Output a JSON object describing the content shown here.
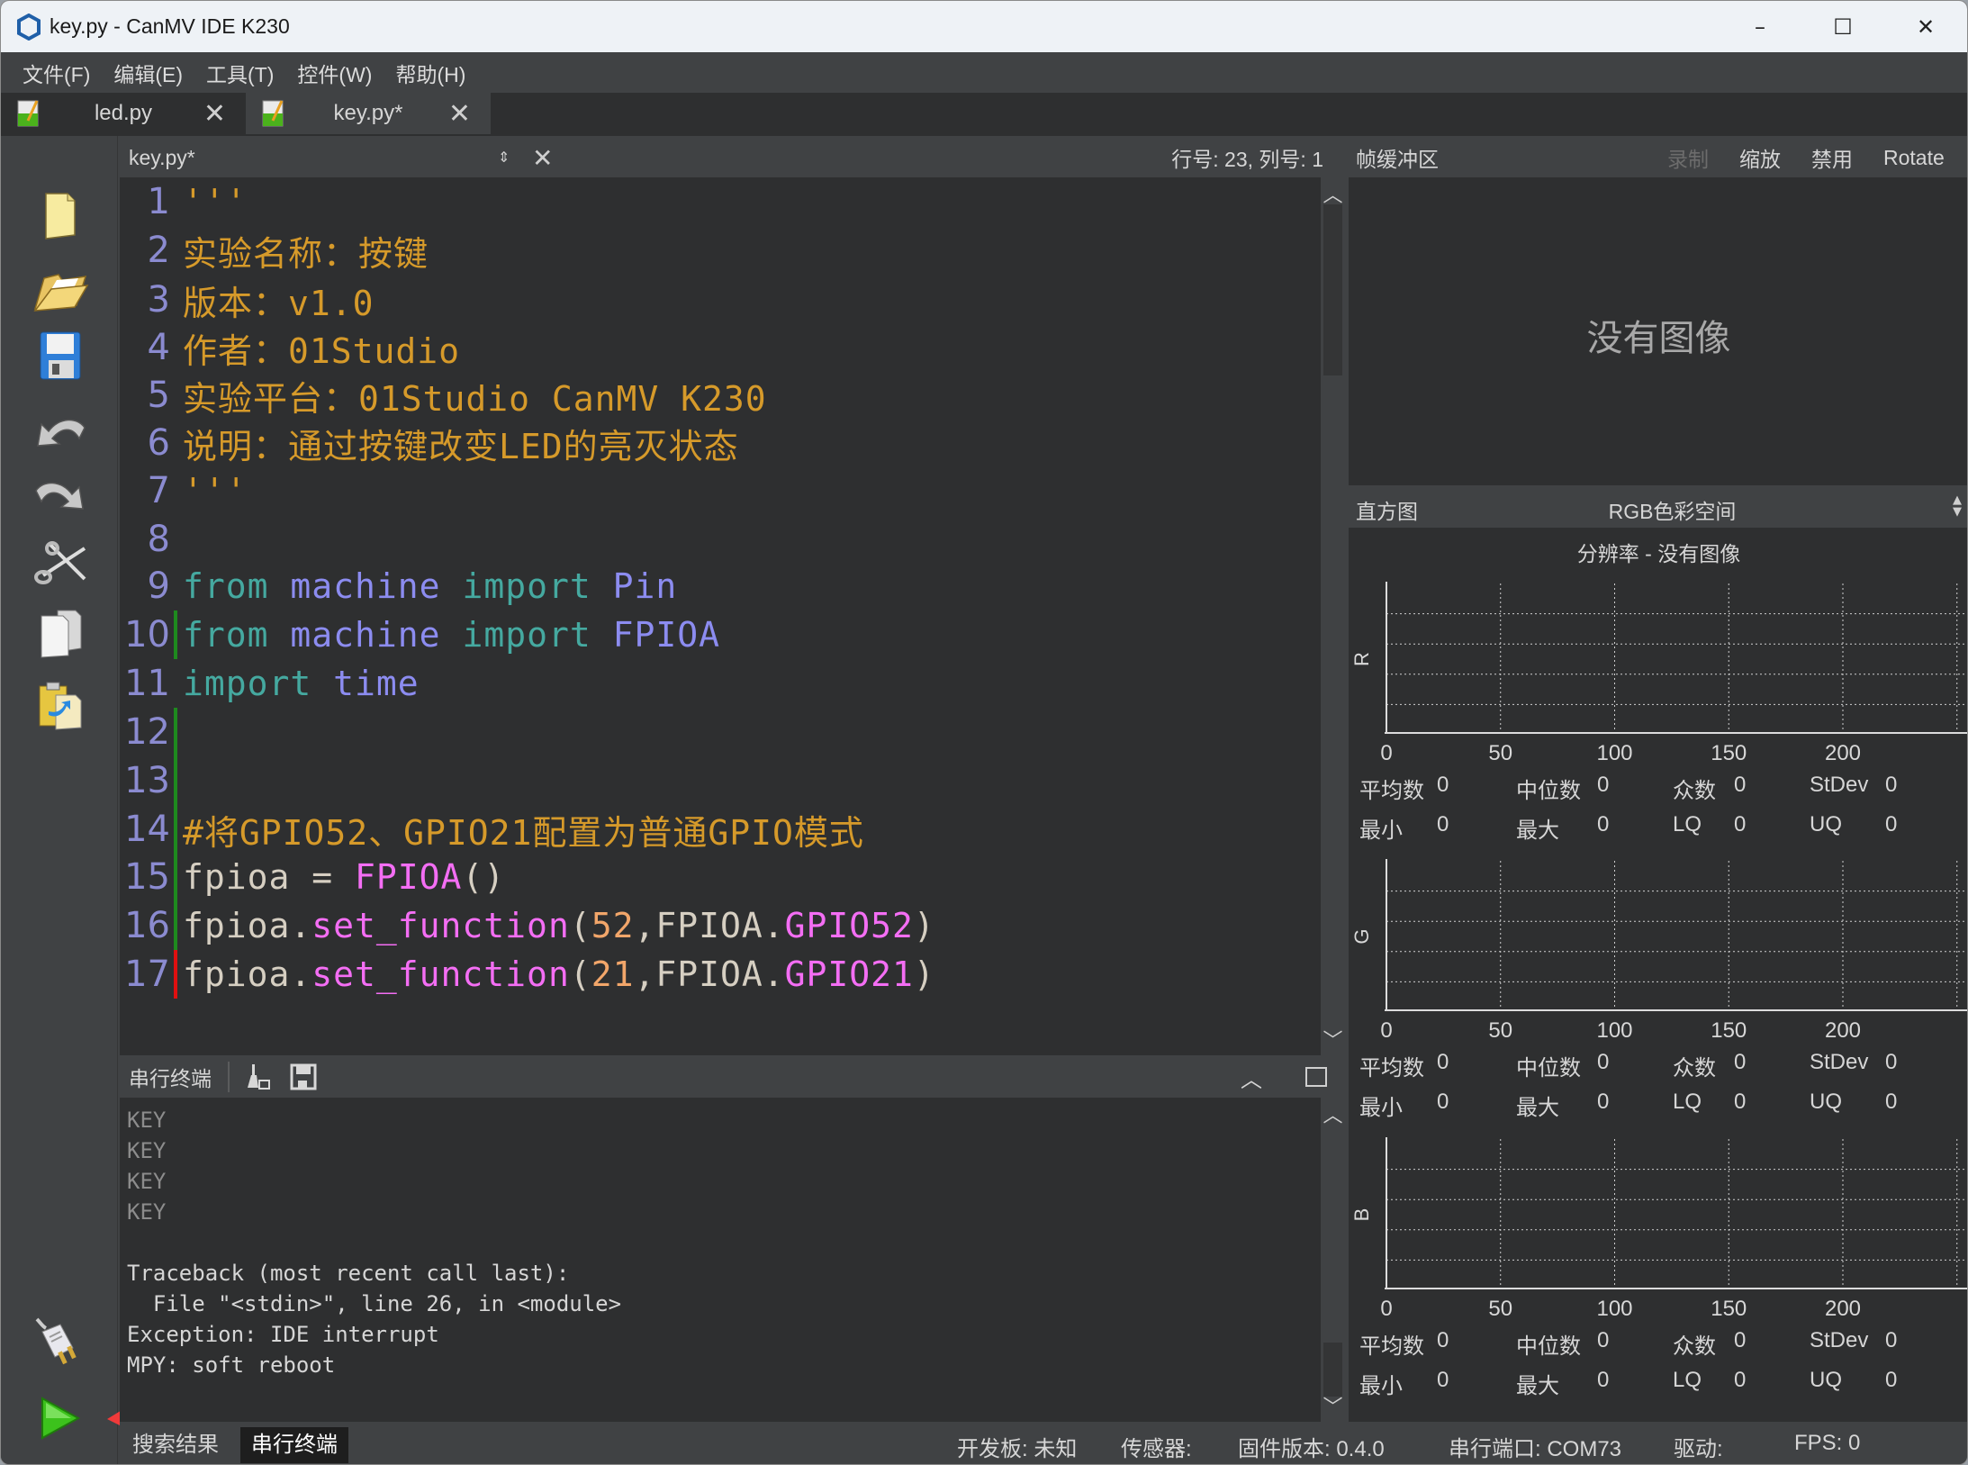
{
  "window": {
    "title": "key.py - CanMV IDE K230",
    "controls": {
      "minimize": "–",
      "maximize": "☐",
      "close": "✕"
    }
  },
  "menu": [
    "文件(F)",
    "编辑(E)",
    "工具(T)",
    "控件(W)",
    "帮助(H)"
  ],
  "tabs": [
    {
      "label": "led.py",
      "active": false,
      "close": "✕"
    },
    {
      "label": "key.py*",
      "active": true,
      "close": "✕"
    }
  ],
  "toolbar": {
    "icons": [
      "new-file-icon",
      "open-folder-icon",
      "save-icon",
      "undo-icon",
      "redo-icon",
      "cut-icon",
      "copy-icon",
      "paste-icon"
    ],
    "connect_icon": "connect-plug-icon",
    "run_icon": "run-icon"
  },
  "editor": {
    "document": "key.py*",
    "switch_glyph": "⇕",
    "close_glyph": "✕",
    "cursor_position": "行号: 23, 列号: 1",
    "lines": [
      {
        "n": "1",
        "mark": "",
        "tokens": [
          {
            "c": "str",
            "t": "'''"
          }
        ]
      },
      {
        "n": "2",
        "mark": "",
        "tokens": [
          {
            "c": "str",
            "t": "实验名称：按键"
          }
        ]
      },
      {
        "n": "3",
        "mark": "",
        "tokens": [
          {
            "c": "str",
            "t": "版本：v1.0"
          }
        ]
      },
      {
        "n": "4",
        "mark": "",
        "tokens": [
          {
            "c": "str",
            "t": "作者：01Studio"
          }
        ]
      },
      {
        "n": "5",
        "mark": "",
        "tokens": [
          {
            "c": "str",
            "t": "实验平台：01Studio CanMV K230"
          }
        ]
      },
      {
        "n": "6",
        "mark": "",
        "tokens": [
          {
            "c": "str",
            "t": "说明：通过按键改变LED的亮灭状态"
          }
        ]
      },
      {
        "n": "7",
        "mark": "",
        "tokens": [
          {
            "c": "str",
            "t": "'''"
          }
        ]
      },
      {
        "n": "8",
        "mark": "",
        "tokens": []
      },
      {
        "n": "9",
        "mark": "",
        "tokens": [
          {
            "c": "kw",
            "t": "from"
          },
          {
            "c": "plain",
            "t": " "
          },
          {
            "c": "mod",
            "t": "machine"
          },
          {
            "c": "plain",
            "t": " "
          },
          {
            "c": "kw",
            "t": "import"
          },
          {
            "c": "plain",
            "t": " "
          },
          {
            "c": "mod",
            "t": "Pin"
          }
        ]
      },
      {
        "n": "10",
        "mark": "green",
        "tokens": [
          {
            "c": "kw",
            "t": "from"
          },
          {
            "c": "plain",
            "t": " "
          },
          {
            "c": "mod",
            "t": "machine"
          },
          {
            "c": "plain",
            "t": " "
          },
          {
            "c": "kw",
            "t": "import"
          },
          {
            "c": "plain",
            "t": " "
          },
          {
            "c": "mod",
            "t": "FPIOA"
          }
        ]
      },
      {
        "n": "11",
        "mark": "",
        "tokens": [
          {
            "c": "kw",
            "t": "import"
          },
          {
            "c": "plain",
            "t": " "
          },
          {
            "c": "mod",
            "t": "time"
          }
        ]
      },
      {
        "n": "12",
        "mark": "green",
        "tokens": []
      },
      {
        "n": "13",
        "mark": "green",
        "tokens": []
      },
      {
        "n": "14",
        "mark": "green",
        "tokens": [
          {
            "c": "str",
            "t": "#将GPIO52、GPIO21配置为普通GPIO模式"
          }
        ]
      },
      {
        "n": "15",
        "mark": "green",
        "tokens": [
          {
            "c": "plain",
            "t": "fpioa = "
          },
          {
            "c": "pink",
            "t": "FPIOA"
          },
          {
            "c": "plain",
            "t": "()"
          }
        ]
      },
      {
        "n": "16",
        "mark": "green",
        "tokens": [
          {
            "c": "plain",
            "t": "fpioa."
          },
          {
            "c": "pink",
            "t": "set_function"
          },
          {
            "c": "plain",
            "t": "("
          },
          {
            "c": "num",
            "t": "52"
          },
          {
            "c": "plain",
            "t": ",FPIOA."
          },
          {
            "c": "pink",
            "t": "GPIO52"
          },
          {
            "c": "plain",
            "t": ")"
          }
        ]
      },
      {
        "n": "17",
        "mark": "red",
        "tokens": [
          {
            "c": "plain",
            "t": "fpioa."
          },
          {
            "c": "pink",
            "t": "set_function"
          },
          {
            "c": "plain",
            "t": "("
          },
          {
            "c": "num",
            "t": "21"
          },
          {
            "c": "plain",
            "t": ",FPIOA."
          },
          {
            "c": "pink",
            "t": "GPIO21"
          },
          {
            "c": "plain",
            "t": ")"
          }
        ]
      }
    ]
  },
  "terminal": {
    "title": "串行终端",
    "clear_icon": "clear-broom-icon",
    "save_icon": "save-log-icon",
    "lines": [
      {
        "t": "KEY",
        "dim": true
      },
      {
        "t": "KEY",
        "dim": true
      },
      {
        "t": "KEY",
        "dim": true
      },
      {
        "t": "KEY",
        "dim": true
      },
      {
        "t": "",
        "dim": false
      },
      {
        "t": "Traceback (most recent call last):",
        "dim": false
      },
      {
        "t": "  File \"<stdin>\", line 26, in <module>",
        "dim": false
      },
      {
        "t": "Exception: IDE interrupt",
        "dim": false
      },
      {
        "t": "MPY: soft reboot",
        "dim": false
      }
    ]
  },
  "bottom_tabs": [
    {
      "label": "搜索结果",
      "active": false
    },
    {
      "label": "串行终端",
      "active": true
    }
  ],
  "status": {
    "board": "开发板: 未知",
    "sensor": "传感器:",
    "firmware": "固件版本: 0.4.0",
    "port": "串行端口: COM73",
    "driver": "驱动:",
    "fps": "FPS: 0"
  },
  "framebuffer": {
    "title": "帧缓冲区",
    "buttons": [
      {
        "label": "录制",
        "disabled": true
      },
      {
        "label": "缩放",
        "disabled": false
      },
      {
        "label": "禁用",
        "disabled": false
      },
      {
        "label": "Rotate",
        "disabled": false
      }
    ],
    "placeholder": "没有图像"
  },
  "histogram": {
    "title": "直方图",
    "colorspace": "RGB色彩空间",
    "resolution": "分辨率 - 没有图像",
    "stat_labels": {
      "mean": "平均数",
      "median": "中位数",
      "mode": "众数",
      "stdev": "StDev",
      "min": "最小",
      "max": "最大",
      "lq": "LQ",
      "uq": "UQ"
    }
  },
  "chart_data": [
    {
      "type": "bar",
      "ylabel": "R",
      "x_ticks": [
        "0",
        "50",
        "100",
        "150",
        "200"
      ],
      "xlim": [
        0,
        255
      ],
      "values": [],
      "grid": true,
      "stats": {
        "mean": "0",
        "median": "0",
        "mode": "0",
        "stdev": "0",
        "min": "0",
        "max": "0",
        "lq": "0",
        "uq": "0"
      }
    },
    {
      "type": "bar",
      "ylabel": "G",
      "x_ticks": [
        "0",
        "50",
        "100",
        "150",
        "200"
      ],
      "xlim": [
        0,
        255
      ],
      "values": [],
      "grid": true,
      "stats": {
        "mean": "0",
        "median": "0",
        "mode": "0",
        "stdev": "0",
        "min": "0",
        "max": "0",
        "lq": "0",
        "uq": "0"
      }
    },
    {
      "type": "bar",
      "ylabel": "B",
      "x_ticks": [
        "0",
        "50",
        "100",
        "150",
        "200"
      ],
      "xlim": [
        0,
        255
      ],
      "values": [],
      "grid": true,
      "stats": {
        "mean": "0",
        "median": "0",
        "mode": "0",
        "stdev": "0",
        "min": "0",
        "max": "0",
        "lq": "0",
        "uq": "0"
      }
    }
  ]
}
